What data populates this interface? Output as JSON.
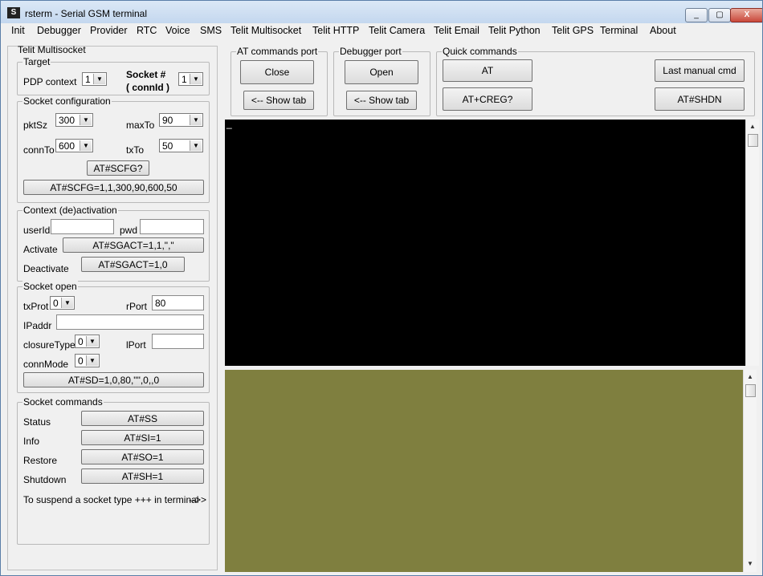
{
  "window": {
    "icon_label": "S",
    "title": "rsterm - Serial GSM terminal",
    "buttons": {
      "minimize": "_",
      "maximize": "▢",
      "close": "X"
    }
  },
  "menu": [
    "Init",
    "Debugger",
    "Provider",
    "RTC",
    "Voice",
    "SMS",
    "Telit Multisocket",
    "Telit HTTP",
    "Telit Camera",
    "Telit Email",
    "Telit Python",
    "Telit GPS",
    "Terminal",
    "About"
  ],
  "left": {
    "panel_title": "Telit Multisocket",
    "target": {
      "title": "Target",
      "pdp_label": "PDP context",
      "pdp_value": "1",
      "socket_label_1": "Socket #",
      "socket_label_2": "( connId )",
      "socket_value": "1"
    },
    "socket_config": {
      "title": "Socket configuration",
      "pktsz_label": "pktSz",
      "pktsz_value": "300",
      "maxto_label": "maxTo",
      "maxto_value": "90",
      "connto_label": "connTo",
      "connto_value": "600",
      "txto_label": "txTo",
      "txto_value": "50",
      "query_btn": "AT#SCFG?",
      "set_btn": "AT#SCFG=1,1,300,90,600,50"
    },
    "context": {
      "title": "Context (de)activation",
      "userid_label": "userId",
      "userid_value": "",
      "pwd_label": "pwd",
      "pwd_value": "",
      "activate_label": "Activate",
      "activate_btn": "AT#SGACT=1,1,\",\"",
      "deactivate_label": "Deactivate",
      "deactivate_btn": "AT#SGACT=1,0"
    },
    "socket_open": {
      "title": "Socket open",
      "txprot_label": "txProt",
      "txprot_value": "0",
      "rport_label": "rPort",
      "rport_value": "80",
      "ipaddr_label": "IPaddr",
      "ipaddr_value": "",
      "closure_label": "closureType",
      "closure_value": "0",
      "lport_label": "lPort",
      "lport_value": "",
      "connmode_label": "connMode",
      "connmode_value": "0",
      "sd_btn": "AT#SD=1,0,80,\"\",0,,0"
    },
    "socket_cmds": {
      "title": "Socket commands",
      "status_label": "Status",
      "status_btn": "AT#SS",
      "info_label": "Info",
      "info_btn": "AT#SI=1",
      "restore_label": "Restore",
      "restore_btn": "AT#SO=1",
      "shutdown_label": "Shutdown",
      "shutdown_btn": "AT#SH=1",
      "suspend_note": "To suspend a socket type +++ in terminal",
      "arrow": "-->>"
    }
  },
  "top": {
    "at_port": {
      "title": "AT commands port",
      "close_btn": "Close",
      "show_tab_btn": "<-- Show tab"
    },
    "debug_port": {
      "title": "Debugger port",
      "open_btn": "Open",
      "show_tab_btn": "<-- Show tab"
    },
    "quick": {
      "title": "Quick commands",
      "at_btn": "AT",
      "creg_btn": "AT+CREG?",
      "last_btn": "Last manual cmd",
      "shdn_btn": "AT#SHDN"
    }
  },
  "terminal": {
    "cursor": "_"
  }
}
